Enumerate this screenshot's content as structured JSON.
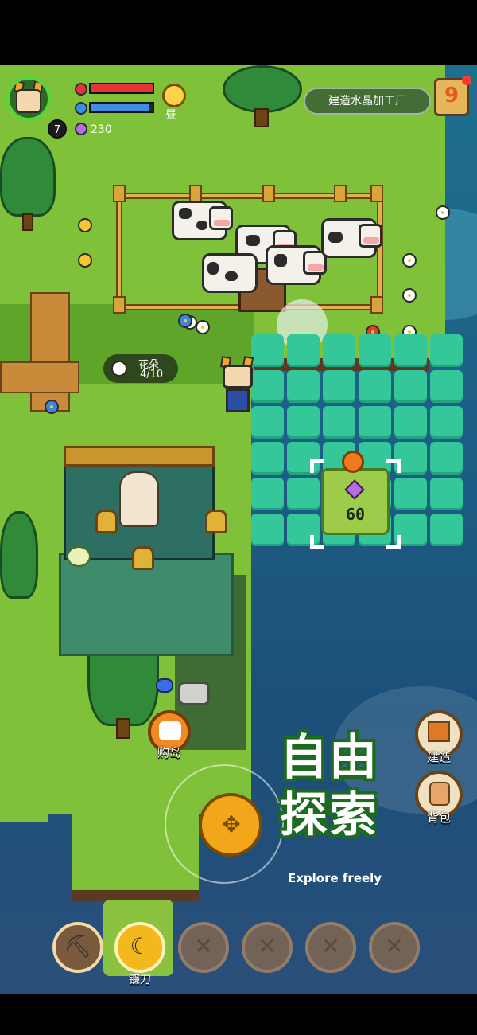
{
  "hud": {
    "level": "7",
    "crystals": "230",
    "day_label": "昼",
    "health_fraction": 1.0,
    "energy_fraction": 0.95
  },
  "quest": {
    "text": "建造水晶加工厂"
  },
  "calendar": {
    "day": "9"
  },
  "flower_counter": {
    "label": "花朵",
    "value": "4/10"
  },
  "plot": {
    "price": "60"
  },
  "buttons": {
    "buy_island": "购岛",
    "build": "建造",
    "bag": "背包"
  },
  "promo": {
    "title_line1": "自由",
    "title_line2": "探索",
    "subtitle": "Explore freely"
  },
  "toolbar": {
    "active_tool_label": "镰刀"
  },
  "colors": {
    "grass": "#7fc23a",
    "water": "#1e6f8e",
    "farm_tile": "#33c79a",
    "accent_orange": "#f2a71a",
    "health_red": "#e63535",
    "energy_blue": "#3e8ee8"
  }
}
